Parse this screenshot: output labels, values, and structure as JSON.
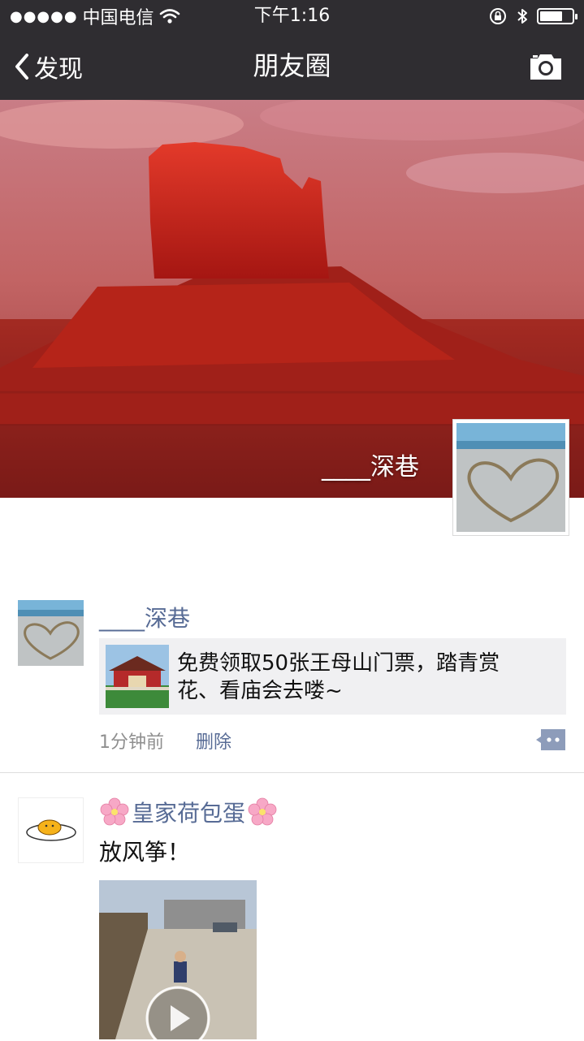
{
  "status_bar": {
    "signal_dots": "●●●●●",
    "carrier": "中国电信",
    "wifi_icon": "wifi-icon",
    "time": "下午1:16",
    "icons": [
      "orientation-lock-icon",
      "bluetooth-icon",
      "battery-icon"
    ],
    "battery_level": 0.7
  },
  "nav": {
    "back_label": "发现",
    "title": "朋友圈",
    "camera_icon": "camera-icon"
  },
  "cover": {
    "user_name": "____深巷"
  },
  "feed": {
    "posts": [
      {
        "name": "____深巷",
        "share_text": "免费领取50张王母山门票，踏青赏花、看庙会去喽~",
        "time": "1分钟前",
        "delete_label": "删除",
        "comment_icon": "comment-icon"
      },
      {
        "name_prefix_icon": "cherry-blossom-icon",
        "name": "皇家荷包蛋",
        "name_suffix_icon": "cherry-blossom-icon",
        "text": "放风筝！",
        "media_icon": "play-icon"
      }
    ]
  },
  "colors": {
    "bar_bg": "#2f2d31",
    "link_blue": "#576b95",
    "share_bg": "#f0f0f2"
  }
}
